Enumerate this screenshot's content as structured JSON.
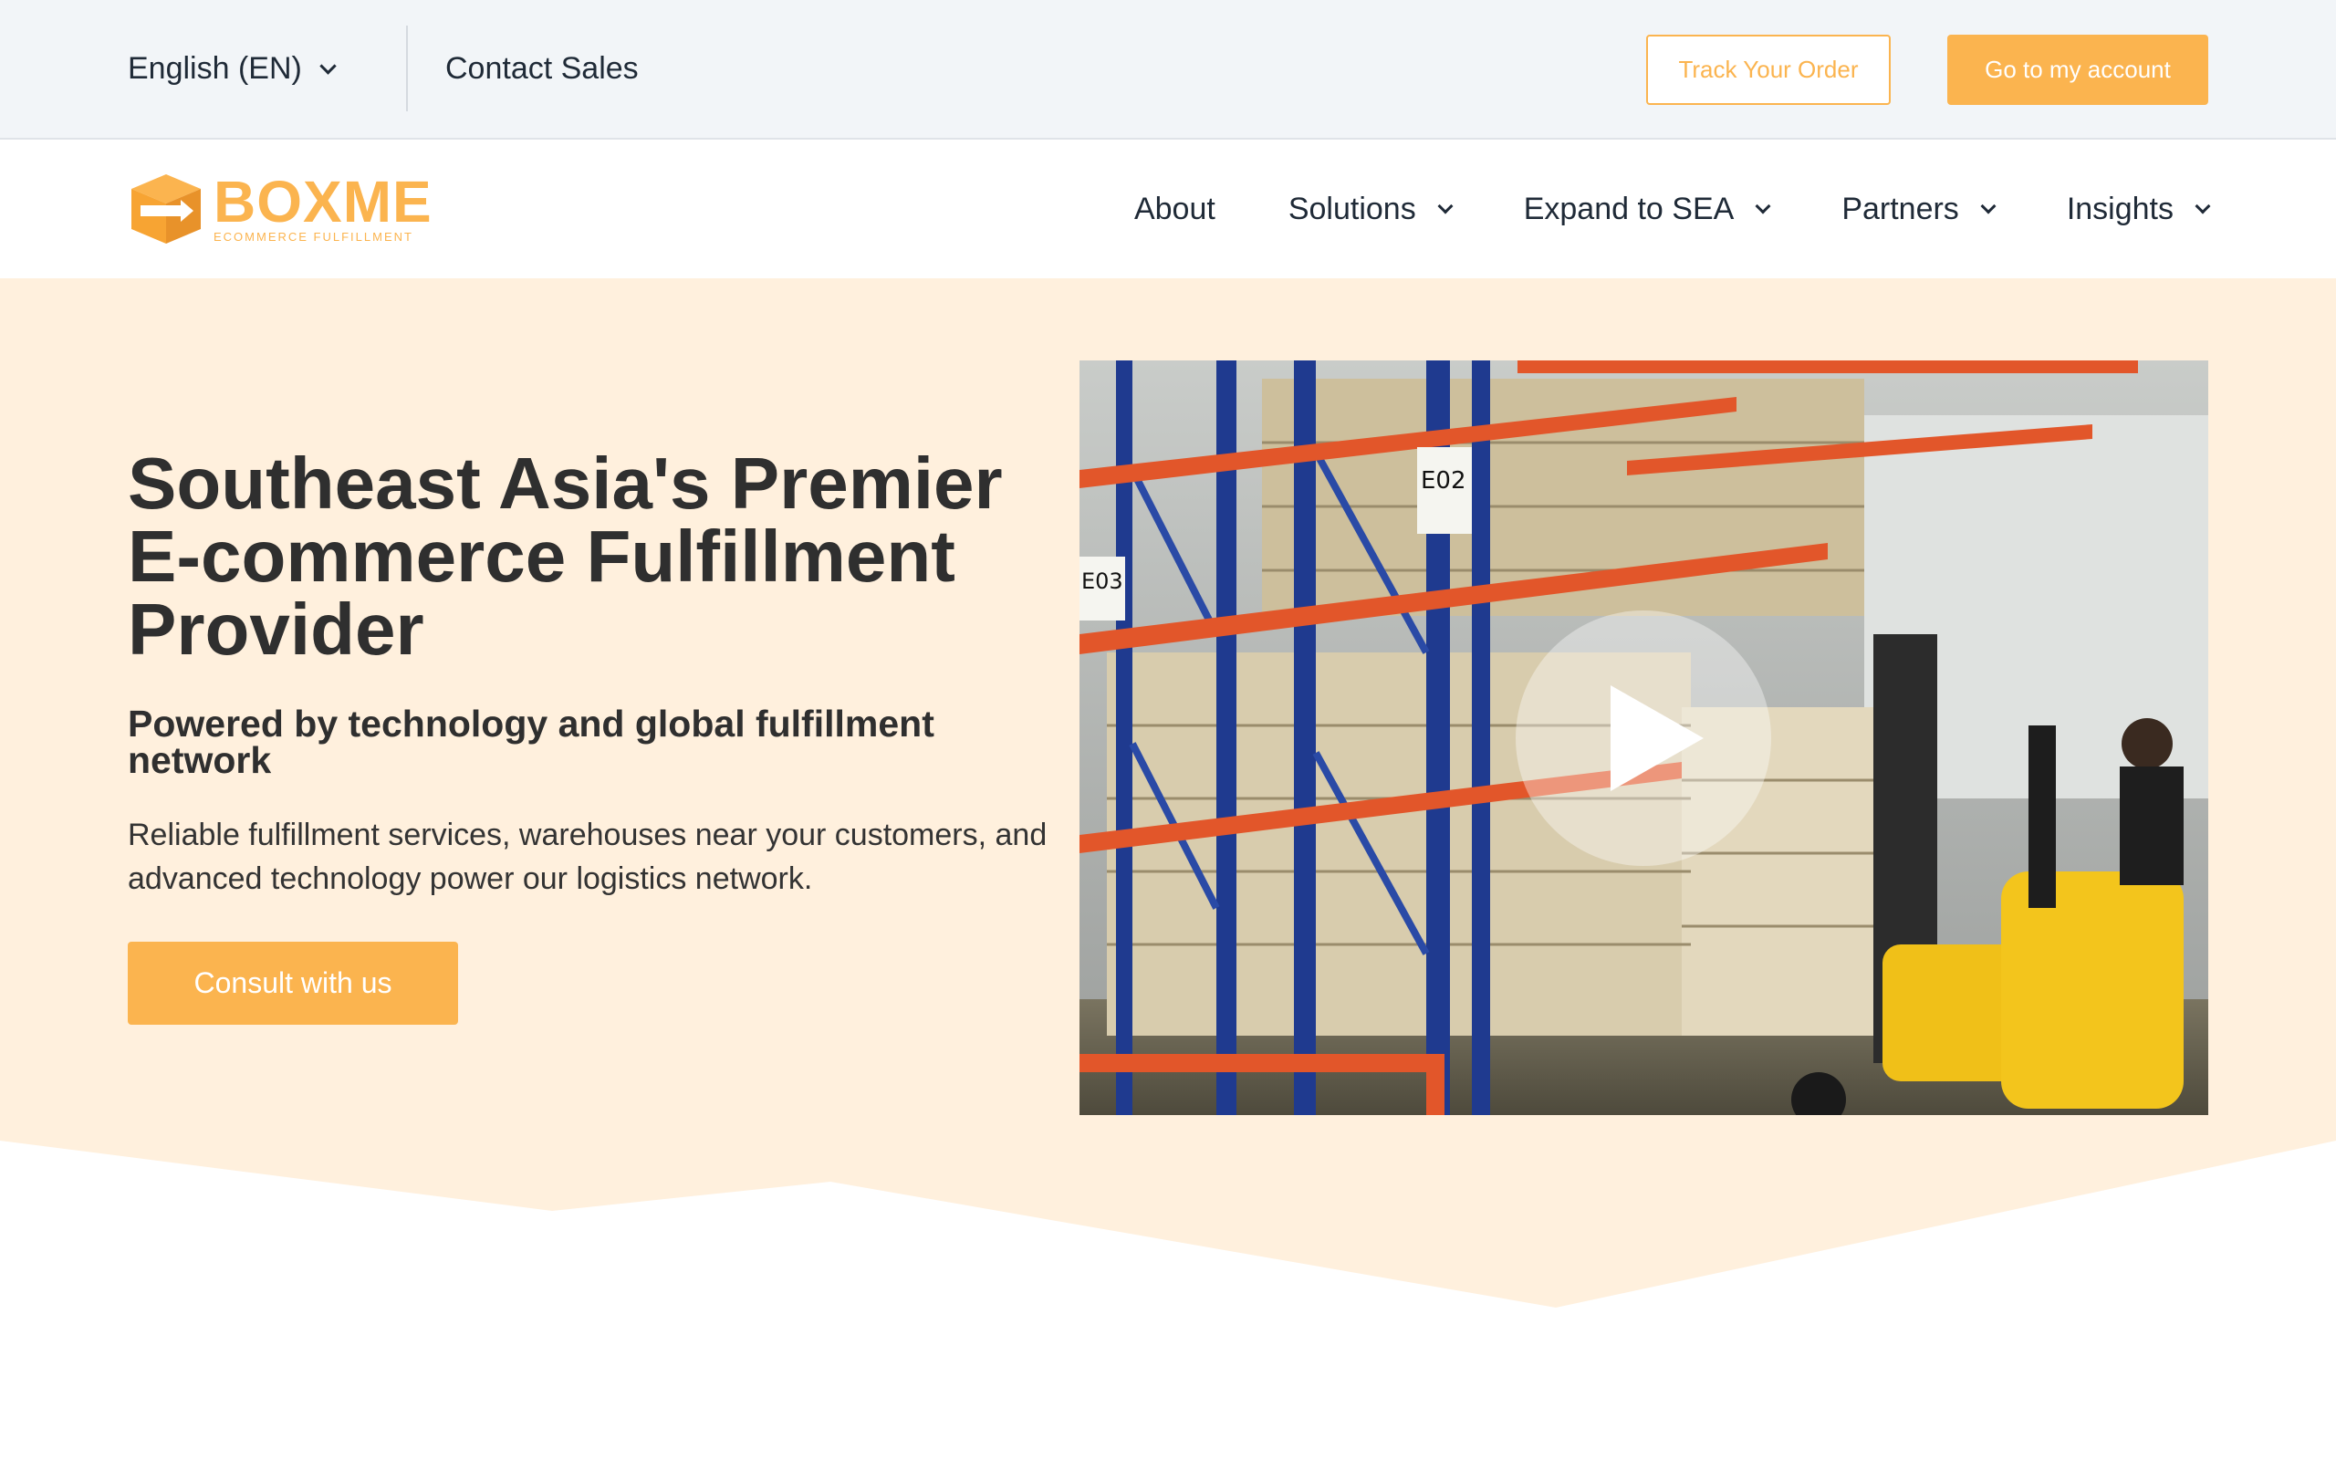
{
  "topbar": {
    "language": "English (EN)",
    "contact_sales": "Contact Sales",
    "track_order": "Track Your Order",
    "my_account": "Go to my account"
  },
  "brand": {
    "name": "BOXME",
    "tagline": "ECOMMERCE FULFILLMENT",
    "color": "#fbb44f"
  },
  "nav": {
    "items": [
      {
        "label": "About",
        "has_dropdown": false
      },
      {
        "label": "Solutions",
        "has_dropdown": true
      },
      {
        "label": "Expand to SEA",
        "has_dropdown": true
      },
      {
        "label": "Partners",
        "has_dropdown": true
      },
      {
        "label": "Insights",
        "has_dropdown": true
      }
    ]
  },
  "hero": {
    "title": "Southeast Asia's Premier E-commerce Fulfillment Provider",
    "subtitle": "Powered by technology and global fulfillment network",
    "description": "Reliable fulfillment services, warehouses near your customers, and advanced technology power our logistics network.",
    "cta": "Consult with us",
    "background_color": "#fff0dd"
  },
  "video": {
    "icon": "play-icon"
  }
}
